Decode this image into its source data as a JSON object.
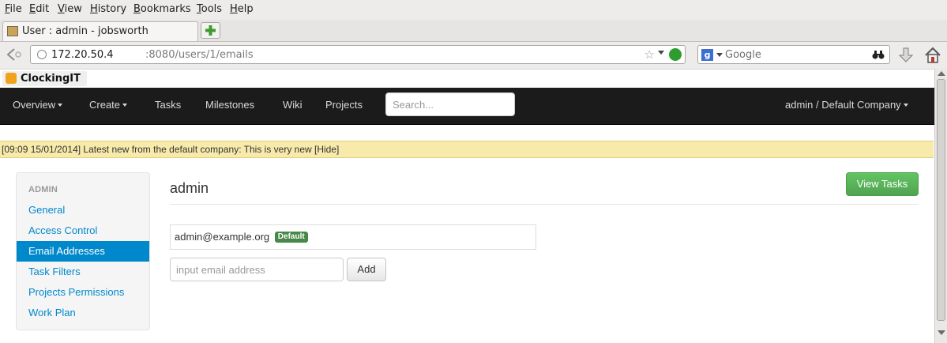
{
  "browser": {
    "menu": [
      "File",
      "Edit",
      "View",
      "History",
      "Bookmarks",
      "Tools",
      "Help"
    ],
    "tab_title": "User : admin - jobsworth",
    "url_host": "172.20.50.4",
    "url_path": ":8080/users/1/emails",
    "search_placeholder": "Google",
    "search_engine_letter": "g"
  },
  "app": {
    "logo_text": "ClockingIT",
    "nav": {
      "overview": "Overview",
      "create": "Create",
      "tasks": "Tasks",
      "milestones": "Milestones",
      "wiki": "Wiki",
      "projects": "Projects",
      "search_placeholder": "Search...",
      "user_menu": "admin / Default Company"
    },
    "news": "[09:09 15/01/2014] Latest new from the default company: This is very new [Hide]",
    "sidebar": {
      "header": "ADMIN",
      "items": [
        {
          "label": "General",
          "active": false
        },
        {
          "label": "Access Control",
          "active": false
        },
        {
          "label": "Email Addresses",
          "active": true
        },
        {
          "label": "Task Filters",
          "active": false
        },
        {
          "label": "Projects Permissions",
          "active": false
        },
        {
          "label": "Work Plan",
          "active": false
        }
      ]
    },
    "main": {
      "title": "admin",
      "view_tasks_label": "View Tasks",
      "email": "admin@example.org",
      "default_badge": "Default",
      "email_input_placeholder": "input email address",
      "add_label": "Add"
    }
  },
  "colors": {
    "accent": "#0088cc",
    "nav_bg": "#1b1b1b",
    "success": "#5bb75b",
    "news_bg": "#f7eaab",
    "badge": "#468847"
  }
}
